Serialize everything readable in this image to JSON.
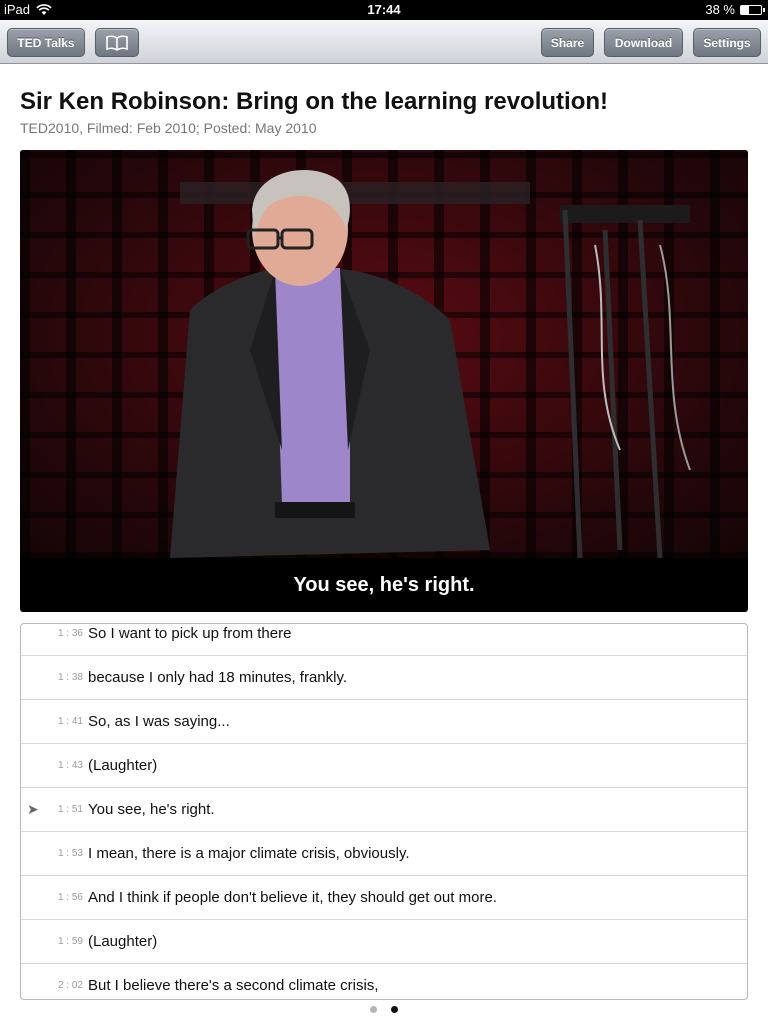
{
  "status_bar": {
    "device": "iPad",
    "time": "17:44",
    "battery": "38 %",
    "battery_level": 0.38
  },
  "toolbar": {
    "ted_talks_label": "TED Talks",
    "bookmarks_icon": "book-icon",
    "share_label": "Share",
    "download_label": "Download",
    "settings_label": "Settings"
  },
  "talk": {
    "title": "Sir Ken Robinson: Bring on the learning revolution!",
    "meta": "TED2010, Filmed: Feb 2010; Posted: May 2010"
  },
  "video": {
    "caption": "You see, he's right."
  },
  "transcript": [
    {
      "time": "1 : 36",
      "text": "So I want to pick up from there",
      "current": false
    },
    {
      "time": "1 : 38",
      "text": "because I only had 18 minutes, frankly.",
      "current": false
    },
    {
      "time": "1 : 41",
      "text": "So, as I was saying...",
      "current": false
    },
    {
      "time": "1 : 43",
      "text": "(Laughter)",
      "current": false
    },
    {
      "time": "1 : 51",
      "text": "You see, he's right.",
      "current": true,
      "marker": "➤"
    },
    {
      "time": "1 : 53",
      "text": "I mean, there is a major climate crisis, obviously.",
      "current": false
    },
    {
      "time": "1 : 56",
      "text": "And I think if people don't believe it, they should get out more.",
      "current": false
    },
    {
      "time": "1 : 59",
      "text": "(Laughter)",
      "current": false
    },
    {
      "time": "2 : 02",
      "text": "But I believe there's a second climate crisis,",
      "current": false
    }
  ],
  "page_control": {
    "pages": 2,
    "current_page": 2
  }
}
